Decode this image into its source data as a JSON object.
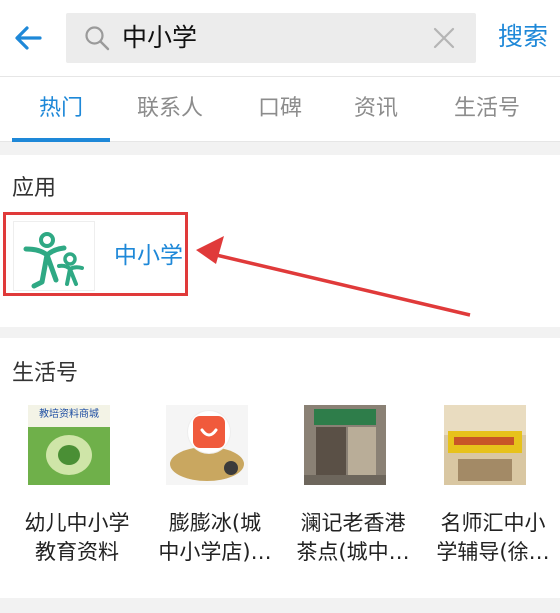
{
  "search": {
    "query": "中小学",
    "button_label": "搜索"
  },
  "tabs": [
    {
      "label": "热门",
      "active": true
    },
    {
      "label": "联系人",
      "active": false
    },
    {
      "label": "口碑",
      "active": false
    },
    {
      "label": "资讯",
      "active": false
    },
    {
      "label": "生活号",
      "active": false
    }
  ],
  "apps": {
    "title": "应用",
    "items": [
      {
        "name": "中小学",
        "icon": "education-logo-icon",
        "highlighted": true
      }
    ]
  },
  "life_accounts": {
    "title": "生活号",
    "items": [
      {
        "name_line1": "幼儿中小学",
        "name_line2": "教育资料",
        "thumb_text": "教培资料商城"
      },
      {
        "name_line1": "膨膨冰(城",
        "name_line2": "中小学店)…"
      },
      {
        "name_line1": "澜记老香港",
        "name_line2": "茶点(城中…"
      },
      {
        "name_line1": "名师汇中小",
        "name_line2": "学辅导(徐…"
      }
    ]
  },
  "colors": {
    "accent": "#1e88d8",
    "highlight_red": "#e03a3a",
    "logo_green": "#2fa984"
  }
}
